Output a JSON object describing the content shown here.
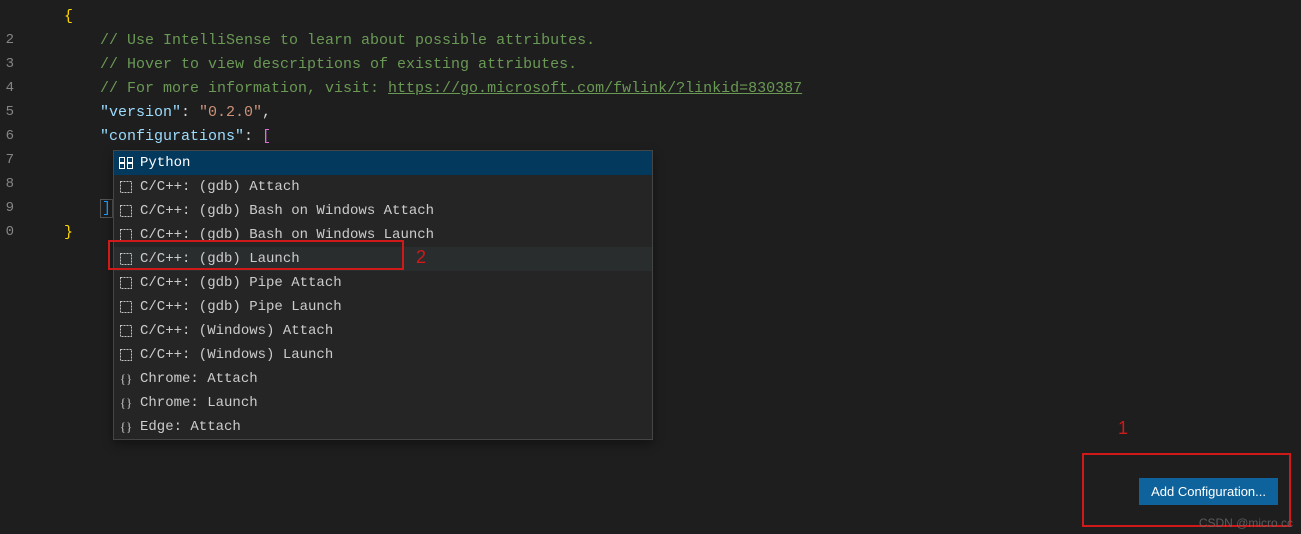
{
  "code": {
    "c1": "// Use IntelliSense to learn about possible attributes.",
    "c2": "// Hover to view descriptions of existing attributes.",
    "c3a": "// For more information, visit: ",
    "c3b": "https://go.microsoft.com/fwlink/?linkid=830387",
    "ver_key": "\"version\"",
    "ver_val": "\"0.2.0\"",
    "conf_key": "\"configurations\""
  },
  "gutter": [
    "2",
    "3",
    "4",
    "5",
    "6",
    "7",
    "8",
    "9",
    "0"
  ],
  "suggest": {
    "items": [
      {
        "icon": "module",
        "label": "Python",
        "sel": true
      },
      {
        "icon": "snippet",
        "label": "C/C++: (gdb) Attach"
      },
      {
        "icon": "snippet",
        "label": "C/C++: (gdb) Bash on Windows Attach"
      },
      {
        "icon": "snippet",
        "label": "C/C++: (gdb) Bash on Windows Launch"
      },
      {
        "icon": "snippet",
        "label": "C/C++: (gdb) Launch",
        "dim": true
      },
      {
        "icon": "snippet",
        "label": "C/C++: (gdb) Pipe Attach"
      },
      {
        "icon": "snippet",
        "label": "C/C++: (gdb) Pipe Launch"
      },
      {
        "icon": "snippet",
        "label": "C/C++: (Windows) Attach"
      },
      {
        "icon": "snippet",
        "label": "C/C++: (Windows) Launch"
      },
      {
        "icon": "braces",
        "label": "Chrome: Attach"
      },
      {
        "icon": "braces",
        "label": "Chrome: Launch"
      },
      {
        "icon": "braces",
        "label": "Edge: Attach"
      }
    ]
  },
  "button": {
    "add": "Add Configuration..."
  },
  "anno": {
    "n1": "1",
    "n2": "2"
  },
  "watermark": "CSDN @micro cc"
}
